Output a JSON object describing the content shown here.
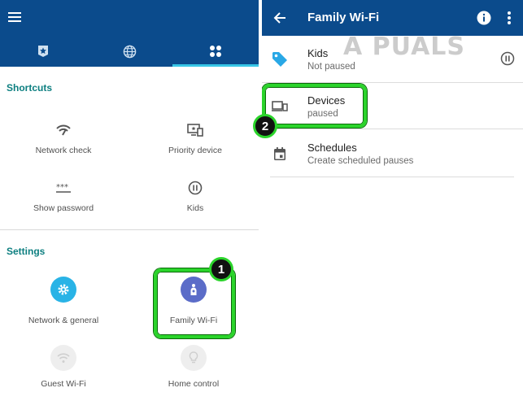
{
  "left": {
    "sections": {
      "shortcuts_title": "Shortcuts",
      "settings_title": "Settings"
    },
    "shortcuts": [
      {
        "label": "Network check",
        "icon": "network-check-icon"
      },
      {
        "label": "Priority device",
        "icon": "priority-device-icon"
      },
      {
        "label": "Show password",
        "icon": "password-icon"
      },
      {
        "label": "Kids",
        "icon": "pause-icon"
      }
    ],
    "settings": [
      {
        "label": "Network & general",
        "icon": "gear-icon"
      },
      {
        "label": "Family Wi-Fi",
        "icon": "family-icon"
      },
      {
        "label": "Guest Wi-Fi",
        "icon": "wifi-icon"
      },
      {
        "label": "Home control",
        "icon": "lightbulb-icon"
      }
    ],
    "tabs": [
      "star-tab-icon",
      "globe-icon",
      "apps-icon"
    ],
    "step_badge": "1"
  },
  "right": {
    "title": "Family Wi-Fi",
    "rows": [
      {
        "title": "Kids",
        "subtitle": "Not paused",
        "icon": "tag-icon"
      },
      {
        "title": "Devices",
        "subtitle": "paused",
        "icon": "devices-icon"
      },
      {
        "title": "Schedules",
        "subtitle": "Create scheduled pauses",
        "icon": "calendar-icon"
      }
    ],
    "step_badge": "2"
  },
  "watermark": "A  PUALS",
  "colors": {
    "header": "#0b4b8c",
    "accent_tab": "#37c6e6",
    "section_title": "#0d7f80",
    "highlight": "#2bd42b",
    "gear_circle": "#29b3e6",
    "family_circle": "#5b6cc8"
  }
}
